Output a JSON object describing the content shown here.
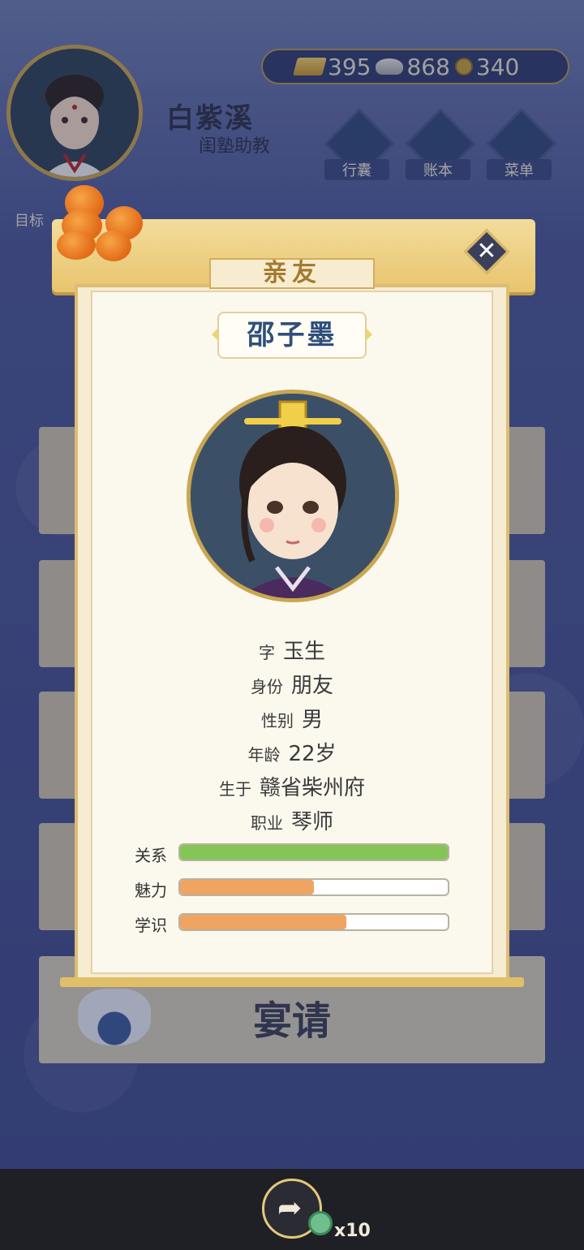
{
  "player": {
    "name": "白紫溪",
    "title": "闺塾助教"
  },
  "currency": {
    "gold": "395",
    "silver": "868",
    "coins": "340"
  },
  "nav": [
    {
      "label": "行囊",
      "icon": "bag-icon"
    },
    {
      "label": "账本",
      "icon": "ledger-icon"
    },
    {
      "label": "菜单",
      "icon": "menu-icon"
    }
  ],
  "goal_label": "目标",
  "modal": {
    "title": "亲友",
    "character_name": "邵子墨",
    "info": [
      {
        "key": "字",
        "value": "玉生"
      },
      {
        "key": "身份",
        "value": "朋友"
      },
      {
        "key": "性别",
        "value": "男"
      },
      {
        "key": "年龄",
        "value": "22岁"
      },
      {
        "key": "生于",
        "value": "赣省柴州府"
      },
      {
        "key": "职业",
        "value": "琴师"
      }
    ],
    "stats": [
      {
        "label": "关系",
        "fraction": 1.0,
        "color": "#84c557"
      },
      {
        "label": "魅力",
        "fraction": 0.5,
        "color": "#f0a462"
      },
      {
        "label": "学识",
        "fraction": 0.62,
        "color": "#f0a462"
      }
    ]
  },
  "feast_label": "宴请",
  "bottom": {
    "share_count": "x10"
  }
}
